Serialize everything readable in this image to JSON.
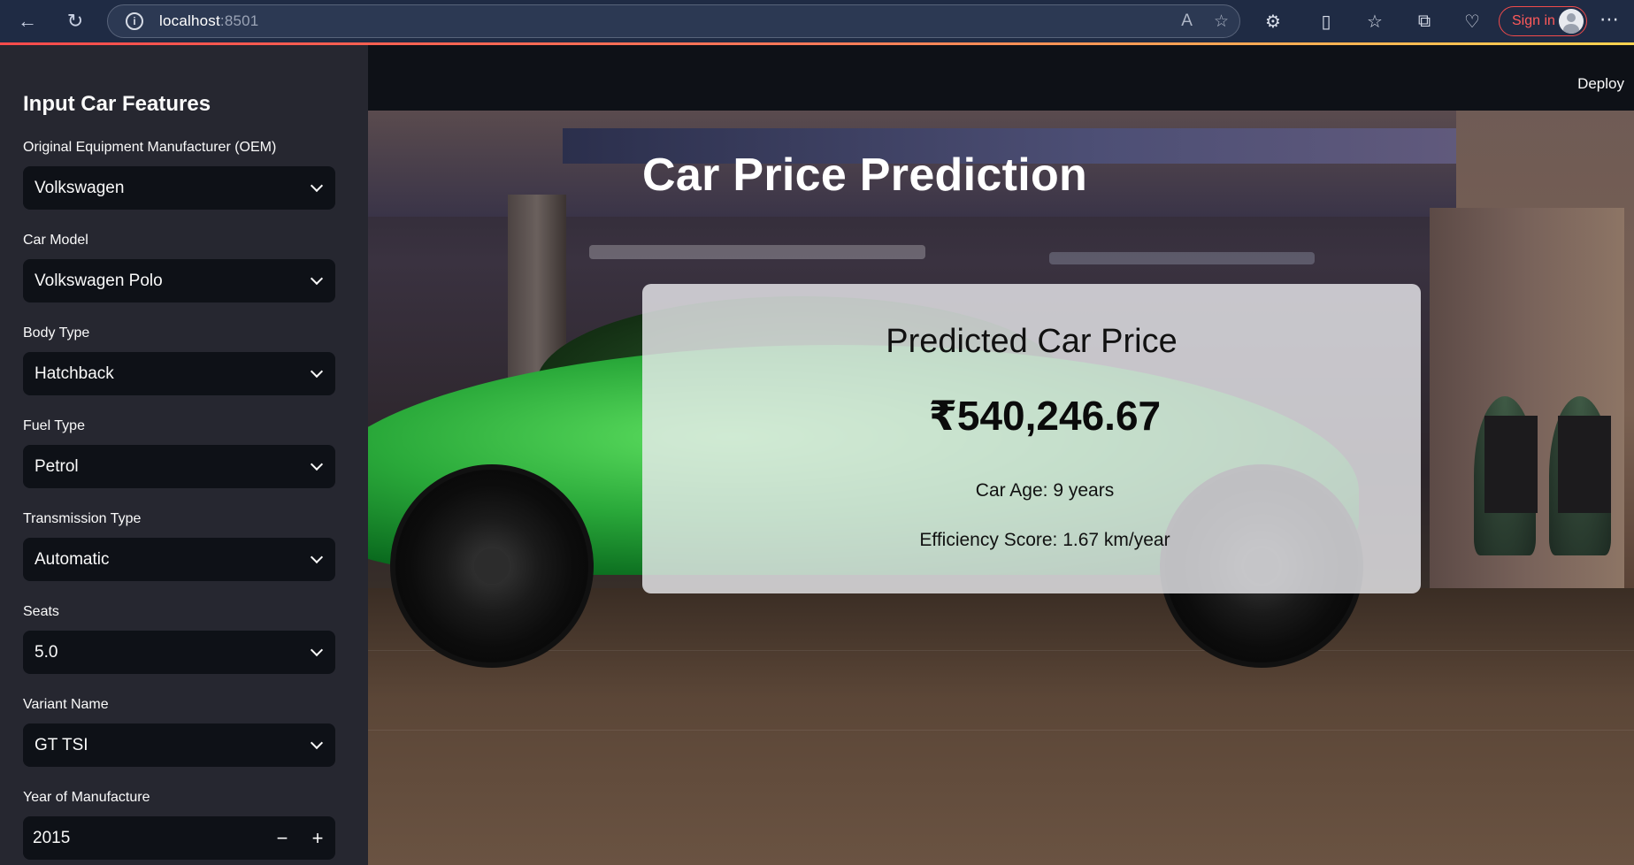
{
  "browser": {
    "url_host": "localhost",
    "url_port": ":8501",
    "sign_in_label": "Sign in"
  },
  "sidebar": {
    "title": "Input Car Features",
    "fields": [
      {
        "label": "Original Equipment Manufacturer (OEM)",
        "value": "Volkswagen"
      },
      {
        "label": "Car Model",
        "value": "Volkswagen Polo"
      },
      {
        "label": "Body Type",
        "value": "Hatchback"
      },
      {
        "label": "Fuel Type",
        "value": "Petrol"
      },
      {
        "label": "Transmission Type",
        "value": "Automatic"
      },
      {
        "label": "Seats",
        "value": "5.0"
      },
      {
        "label": "Variant Name",
        "value": "GT TSI"
      }
    ],
    "year": {
      "label": "Year of Manufacture",
      "value": "2015",
      "minus": "−",
      "plus": "+"
    }
  },
  "header": {
    "deploy_label": "Deploy"
  },
  "main": {
    "title": "Car Price Prediction",
    "result": {
      "heading": "Predicted Car Price",
      "price": "₹540,246.67",
      "car_age": "Car Age: 9 years",
      "efficiency": "Efficiency Score: 1.67 km/year"
    }
  },
  "colors": {
    "sidebar_bg": "#262730",
    "app_bg": "#0e1117",
    "accent": "#ff4b4b",
    "car_green": "#2aa93a"
  }
}
